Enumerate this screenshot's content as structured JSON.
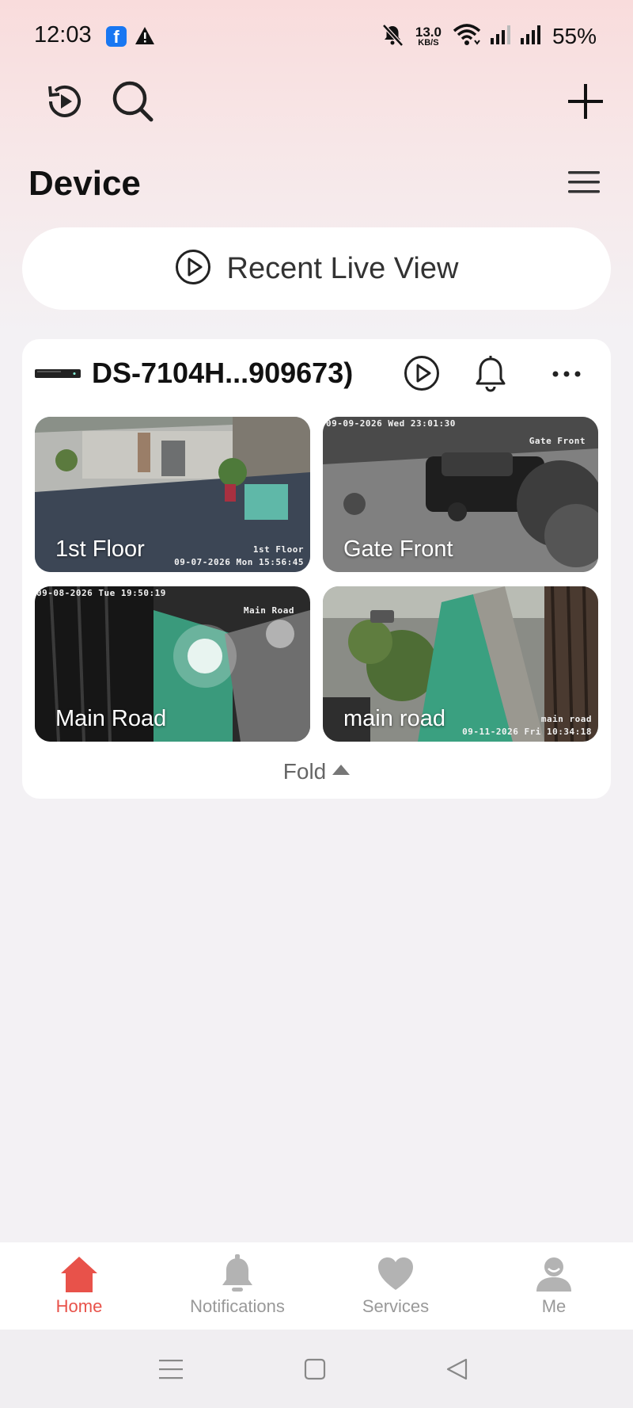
{
  "status_bar": {
    "time": "12:03",
    "speed_value": "13.0",
    "speed_unit": "KB/S",
    "battery": "55%"
  },
  "header": {
    "title": "Device",
    "icons": [
      "history-icon",
      "search-icon",
      "plus-icon",
      "menu-icon"
    ]
  },
  "recent_live_view": {
    "label": "Recent Live View"
  },
  "device": {
    "name": "DS-7104H...909673)",
    "cameras": [
      {
        "label": "1st Floor",
        "osd_name": "1st Floor",
        "osd_time": "09-07-2026 Mon 15:56:45"
      },
      {
        "label": "Gate Front",
        "osd_name": "Gate Front",
        "osd_time": "09-09-2026 Wed 23:01:30"
      },
      {
        "label": "Main Road",
        "osd_name": "Main Road",
        "osd_time": "09-08-2026 Tue 19:50:19"
      },
      {
        "label": "main road",
        "osd_name": "main road",
        "osd_time": "09-11-2026 Fri 10:34:18"
      }
    ],
    "fold_label": "Fold"
  },
  "bottom_nav": [
    {
      "label": "Home",
      "icon": "home-icon",
      "active": true
    },
    {
      "label": "Notifications",
      "icon": "bell-icon",
      "active": false
    },
    {
      "label": "Services",
      "icon": "heart-icon",
      "active": false
    },
    {
      "label": "Me",
      "icon": "user-icon",
      "active": false
    }
  ],
  "colors": {
    "accent": "#e8524a",
    "inactive": "#b3b3b3"
  }
}
